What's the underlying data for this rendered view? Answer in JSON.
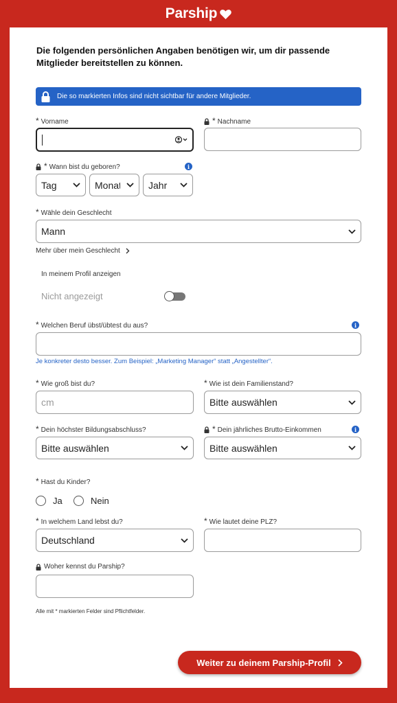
{
  "brand": {
    "name": "Parship",
    "primary_color": "#c8281e",
    "info_color": "#2563c6"
  },
  "intro": "Die folgenden persönlichen Angaben benötigen wir, um dir passende Mitglieder bereitstellen zu können.",
  "info_banner": {
    "icon": "lock-icon",
    "text": "Die so markierten Infos sind nicht sichtbar für andere Mitglieder."
  },
  "required_mark": "*",
  "firstname": {
    "label": "Vorname",
    "value": "",
    "suffix_icon": "person-icon"
  },
  "lastname": {
    "label": "Nachname",
    "value": "",
    "private": true
  },
  "birthdate": {
    "label": "Wann bist du geboren?",
    "private": true,
    "day": "Tag",
    "month": "Monat",
    "year": "Jahr"
  },
  "gender": {
    "label": "Wähle dein Geschlecht",
    "value": "Mann",
    "more_link": "Mehr über mein Geschlecht",
    "profile_display_label": "In meinem Profil anzeigen",
    "profile_display_value": "Nicht angezeigt",
    "profile_display_on": false
  },
  "job": {
    "label": "Welchen Beruf übst/übtest du aus?",
    "value": "",
    "hint": "Je konkreter desto besser. Zum Beispiel: „Marketing Manager“ statt „Angestellter“."
  },
  "height": {
    "label": "Wie groß bist du?",
    "placeholder": "cm"
  },
  "marital": {
    "label": "Wie ist dein Familienstand?",
    "value": "Bitte auswählen"
  },
  "education": {
    "label": "Dein höchster Bildungsabschluss?",
    "value": "Bitte auswählen"
  },
  "income": {
    "label": "Dein jährliches Brutto-Einkommen",
    "value": "Bitte auswählen",
    "private": true
  },
  "children": {
    "label": "Hast du Kinder?",
    "options": [
      "Ja",
      "Nein"
    ]
  },
  "country": {
    "label": "In welchem Land lebst du?",
    "value": "Deutschland"
  },
  "zip": {
    "label": "Wie lautet deine PLZ?",
    "value": ""
  },
  "source": {
    "label": "Woher kennst du Parship?",
    "value": "",
    "private": true
  },
  "footnote": "Alle mit * markierten Felder sind Pflichtfelder.",
  "submit": {
    "label": "Weiter zu deinem Parship-Profil"
  },
  "info_icon_glyph": "i"
}
